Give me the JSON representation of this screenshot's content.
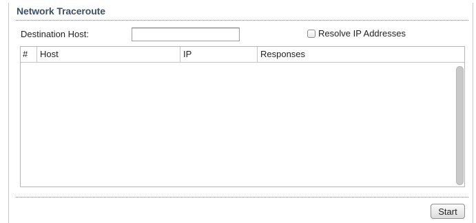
{
  "panel": {
    "title": "Network Traceroute"
  },
  "form": {
    "destination_label": "Destination Host:",
    "destination_value": "",
    "resolve_label": "Resolve IP Addresses",
    "resolve_checked": false
  },
  "table": {
    "columns": [
      "#",
      "Host",
      "IP",
      "Responses"
    ],
    "rows": []
  },
  "actions": {
    "start_label": "Start"
  }
}
